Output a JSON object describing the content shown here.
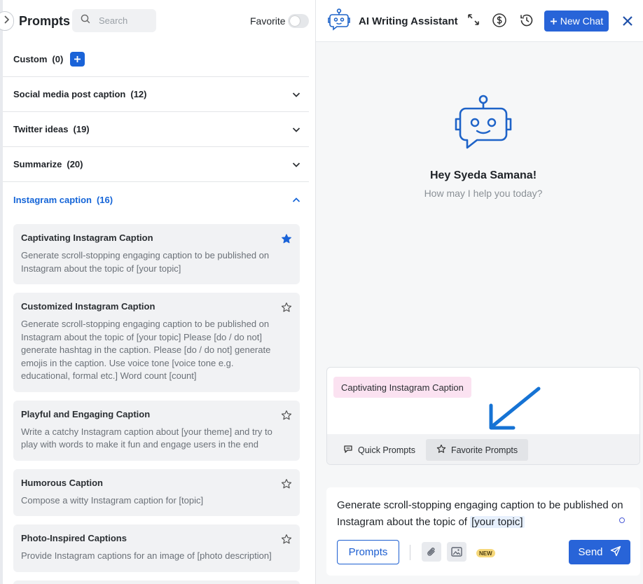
{
  "left_panel": {
    "title": "Prompts",
    "search_placeholder": "Search",
    "favorite_label": "Favorite",
    "favorite_on": false,
    "categories": [
      {
        "label": "Custom",
        "count": "(0)"
      },
      {
        "label": "Social media post caption",
        "count": "(12)"
      },
      {
        "label": "Twitter ideas",
        "count": "(19)"
      },
      {
        "label": "Summarize",
        "count": "(20)"
      },
      {
        "label": "Instagram caption",
        "count": "(16)",
        "expanded": true
      }
    ],
    "prompt_cards": [
      {
        "title": "Captivating Instagram Caption",
        "favorited": true,
        "body": "Generate scroll-stopping engaging caption to be published on Instagram about the topic of [your topic]"
      },
      {
        "title": "Customized Instagram Caption",
        "favorited": false,
        "body": "Generate scroll-stopping engaging caption to be published on Instagram about the topic of [your topic] Please [do / do not] generate hashtag in the caption. Please [do / do not] generate emojis in the caption. Use voice tone [voice tone e.g. educational, formal etc.] Word count [count]"
      },
      {
        "title": "Playful and Engaging Caption",
        "favorited": false,
        "body": "Write a catchy Instagram caption about [your theme] and try to play with words to make it fun and engage users in the end"
      },
      {
        "title": "Humorous Caption",
        "favorited": false,
        "body": "Compose a witty Instagram caption for [topic]"
      },
      {
        "title": "Photo-Inspired Captions",
        "favorited": false,
        "body": "Provide Instagram captions for an image of [photo description]"
      }
    ]
  },
  "right_panel": {
    "app_title": "AI Writing Assistant",
    "new_chat_label": "New Chat",
    "greeting": "Hey Syeda Samana!",
    "subgreeting": "How may I help you today?",
    "selected_chip": "Captivating Instagram Caption",
    "quick_tabs": [
      {
        "label": "Quick Prompts",
        "icon": "quick-prompts-icon",
        "active": false
      },
      {
        "label": "Favorite Prompts",
        "icon": "star-outline-icon",
        "active": true
      }
    ],
    "composer": {
      "text_before": "Generate scroll-stopping engaging caption to be published on Instagram about the topic of",
      "highlight": "[your topic]",
      "prompts_button": "Prompts",
      "new_badge": "NEW",
      "send_label": "Send"
    }
  },
  "colors": {
    "primary": "#2864d8",
    "active_category": "#1565d8",
    "chip_bg": "#fbe2f1",
    "badge_bg": "#f6d87a",
    "annotation_arrow": "#1673d4"
  }
}
